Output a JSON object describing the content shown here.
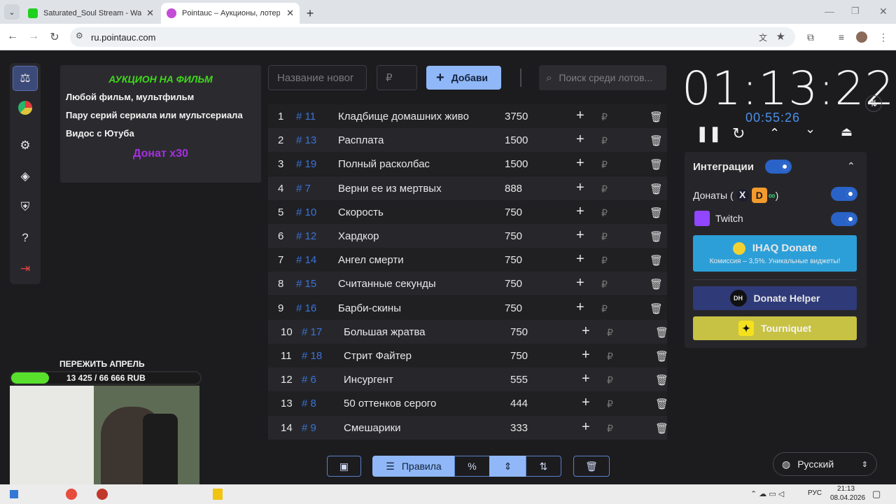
{
  "browser": {
    "tabs": [
      {
        "title": "Saturated_Soul Stream - Watch",
        "color": "#1fd11f"
      },
      {
        "title": "Pointauc – Аукционы, лотереи",
        "color": "#c44cd6"
      }
    ],
    "url": "ru.pointauc.com"
  },
  "rules": {
    "title": "АУКЦИОН НА ФИЛЬМ",
    "lines": [
      "Любой фильм, мультфильм",
      "Пару серий сериала или мультсериала",
      "Видос с Ютуба"
    ],
    "donate": "Донат x30"
  },
  "toolbar": {
    "name_placeholder": "Название новог",
    "amount_placeholder": "₽",
    "add_label": "Добави",
    "search_placeholder": "Поиск среди лотов..."
  },
  "lots": [
    {
      "n": "1",
      "id": "# 11",
      "name": "Кладбище домашних живо",
      "amount": "3750"
    },
    {
      "n": "2",
      "id": "# 13",
      "name": "Расплата",
      "amount": "1500"
    },
    {
      "n": "3",
      "id": "# 19",
      "name": "Полный расколбас",
      "amount": "1500"
    },
    {
      "n": "4",
      "id": "# 7",
      "name": "Верни ее из мертвых",
      "amount": "888"
    },
    {
      "n": "5",
      "id": "# 10",
      "name": "Скорость",
      "amount": "750"
    },
    {
      "n": "6",
      "id": "# 12",
      "name": "Хардкор",
      "amount": "750"
    },
    {
      "n": "7",
      "id": "# 14",
      "name": "Ангел смерти",
      "amount": "750"
    },
    {
      "n": "8",
      "id": "# 15",
      "name": "Считанные секунды",
      "amount": "750"
    },
    {
      "n": "9",
      "id": "# 16",
      "name": "Барби-скины",
      "amount": "750"
    },
    {
      "n": "10",
      "id": "# 17",
      "name": "Большая жратва",
      "amount": "750"
    },
    {
      "n": "11",
      "id": "# 18",
      "name": "Стрит Файтер",
      "amount": "750"
    },
    {
      "n": "12",
      "id": "# 6",
      "name": "Инсургент",
      "amount": "555"
    },
    {
      "n": "13",
      "id": "# 8",
      "name": "50 оттенков серого",
      "amount": "444"
    },
    {
      "n": "14",
      "id": "# 9",
      "name": "Смешарики",
      "amount": "333"
    }
  ],
  "bottom": {
    "rules_label": "Правила"
  },
  "timer": {
    "main": "01:13:22",
    "sub": "00:55:26"
  },
  "integrations": {
    "title": "Интеграции",
    "donations_label": "Донаты (",
    "donations_close": ")",
    "twitch_label": "Twitch",
    "ihaq_title": "IHAQ Donate",
    "ihaq_sub": "Комиссия – 3,5%. Уникальные виджеты!",
    "donate_helper": "Donate Helper",
    "dh_badge": "DH",
    "tourniquet": "Tourniquet"
  },
  "language": "Русский",
  "stream": {
    "goal_title": "ПЕРЕЖИТЬ АПРЕЛЬ",
    "goal_value": "13 425 / 66 666 RUB",
    "goal_fraction": 0.2
  },
  "taskbar": {
    "time": "21:13",
    "date": "08.04.2026",
    "lang": "РУС"
  }
}
